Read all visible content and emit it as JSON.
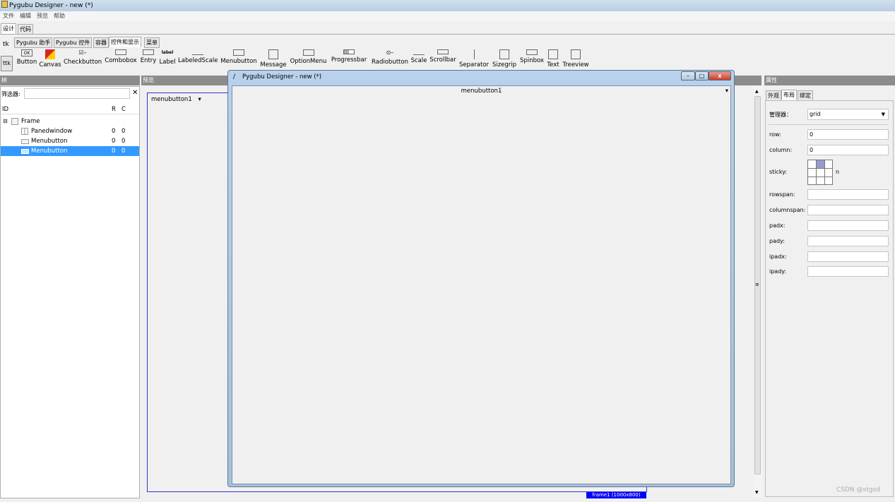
{
  "window": {
    "title": "Pygubu Designer - new (*)"
  },
  "menubar": [
    "文件",
    "编辑",
    "预览",
    "帮助"
  ],
  "main_tabs": [
    "设计",
    "代码"
  ],
  "widget_tabs": {
    "side": "tk",
    "tabs": [
      "Pygubu 助手",
      "Pygubu 控件",
      "容器",
      "控件和显示",
      "菜单"
    ],
    "active_index": 3
  },
  "palette": {
    "side_label": "ttk",
    "items": [
      "Button",
      "Canvas",
      "Checkbutton",
      "Combobox",
      "Entry",
      "Label",
      "LabeledScale",
      "Menubutton",
      "Message",
      "OptionMenu",
      "Progressbar",
      "Radiobutton",
      "Scale",
      "Scrollbar",
      "Separator",
      "Sizegrip",
      "Spinbox",
      "Text",
      "Treeview"
    ]
  },
  "tree": {
    "header": "树",
    "filter_label": "筛选器:",
    "filter_value": "",
    "clear_glyph": "✕",
    "columns": {
      "id": "ID",
      "r": "R",
      "c": "C"
    },
    "rows": [
      {
        "label": "Frame",
        "r": "",
        "c": "",
        "expander": "⊟"
      },
      {
        "label": "Panedwindow",
        "r": "0",
        "c": "0"
      },
      {
        "label": "Menubutton",
        "r": "0",
        "c": "0"
      },
      {
        "label": "Menubutton",
        "r": "0",
        "c": "0",
        "selected": true
      }
    ]
  },
  "preview": {
    "header": "预览",
    "menubutton_label": "menubutton1",
    "menubutton_arrow": "▾",
    "frame_badge": "frame1 (1000x800)"
  },
  "floating_window": {
    "title": "Pygubu Designer - new (*)",
    "menubutton_label": "menubutton1",
    "menubutton_arrow": "▾",
    "buttons": {
      "min": "–",
      "max": "□",
      "close": "x"
    }
  },
  "properties": {
    "header": "属性",
    "tabs": [
      "外观",
      "布局",
      "绑定"
    ],
    "active_tab": 1,
    "manager_label": "管理器：",
    "manager_value": "grid",
    "fields": [
      {
        "label": "row:",
        "value": "0"
      },
      {
        "label": "column:",
        "value": "0"
      },
      {
        "label": "rowspan:",
        "value": ""
      },
      {
        "label": "columnspan:",
        "value": ""
      },
      {
        "label": "padx:",
        "value": ""
      },
      {
        "label": "pady:",
        "value": ""
      },
      {
        "label": "ipadx:",
        "value": ""
      },
      {
        "label": "ipady:",
        "value": ""
      }
    ],
    "sticky_label": "sticky:",
    "sticky_value": "n"
  },
  "scroll_glyphs": {
    "up": "▲",
    "down": "▼",
    "grip": "≡"
  },
  "watermark": "CSDN @stgsd",
  "colors": {
    "selection": "#3399ff",
    "panel_header": "#8c8c8c",
    "badge": "#0000ff"
  }
}
